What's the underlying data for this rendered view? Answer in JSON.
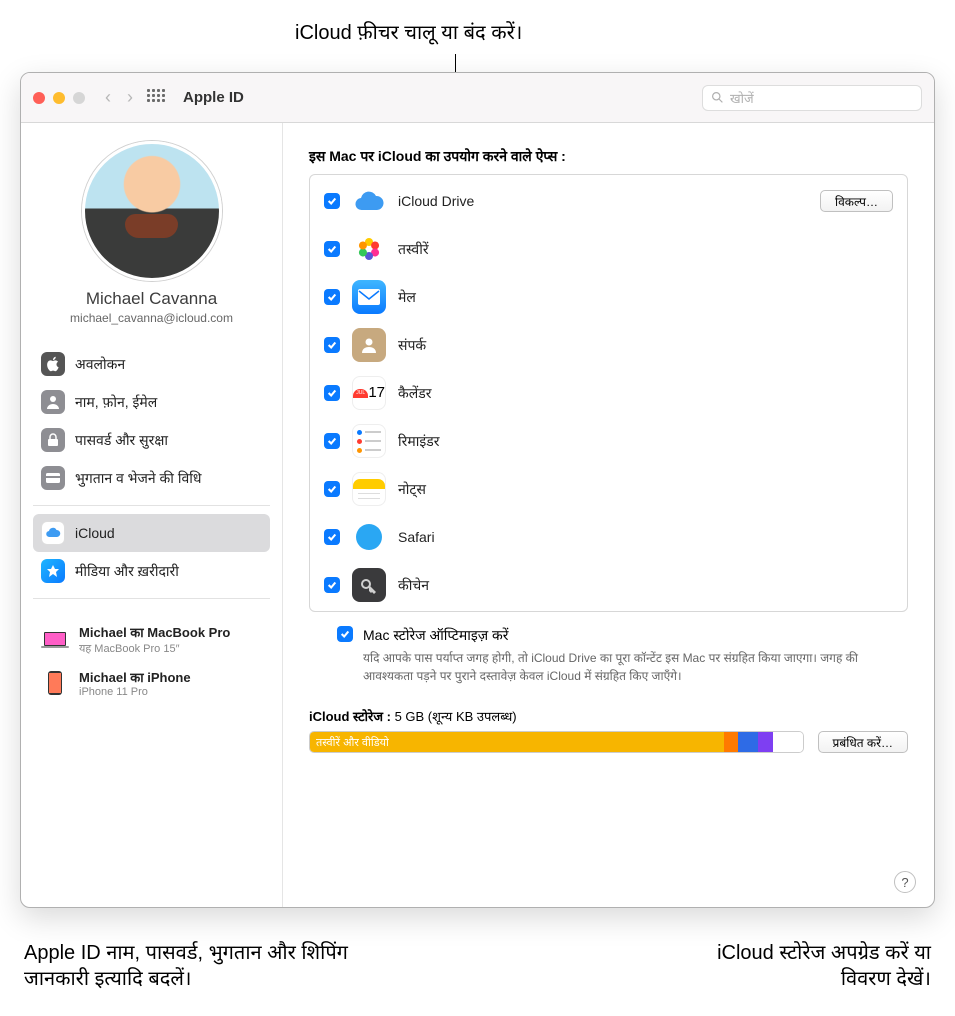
{
  "annotations": {
    "top": "iCloud फ़ीचर चालू या बंद करें।",
    "bottom_left_l1": "Apple ID नाम, पासवर्ड, भुगतान और शिपिंग",
    "bottom_left_l2": "जानकारी इत्यादि बदलें।",
    "bottom_right_l1": "iCloud स्टोरेज अपग्रेड करें या",
    "bottom_right_l2": "विवरण देखें।"
  },
  "window_title": "Apple ID",
  "search_placeholder": "खोजें",
  "user": {
    "name": "Michael Cavanna",
    "email": "michael_cavanna@icloud.com"
  },
  "sidebar": {
    "overview": "अवलोकन",
    "name_phone": "नाम, फ़ोन, ईमेल",
    "password": "पासवर्ड और सुरक्षा",
    "payment": "भुगतान व भेजने की विधि",
    "icloud": "iCloud",
    "media": "मीडिया और ख़रीदारी"
  },
  "devices": {
    "d1": {
      "name": "Michael का MacBook Pro",
      "model": "यह MacBook Pro 15″"
    },
    "d2": {
      "name": "Michael का iPhone",
      "model": "iPhone 11 Pro"
    }
  },
  "main": {
    "apps_heading": "इस Mac पर iCloud का उपयोग करने वाले ऐप्स :",
    "options_btn": "विकल्प…",
    "apps": {
      "drive": "iCloud Drive",
      "photos": "तस्वीरें",
      "mail": "मेल",
      "contacts": "संपर्क",
      "calendar": "कैलेंडर",
      "reminders": "रिमाइंडर",
      "notes": "नोट्स",
      "safari": "Safari",
      "keychain": "कीचेन"
    },
    "optimize_title": "Mac स्टोरेज ऑप्टिमाइज़ करें",
    "optimize_desc": "यदि आपके पास पर्याप्त जगह होगी, तो iCloud Drive का पूरा कॉन्टेंट इस Mac पर संग्रहित किया जाएगा। जगह की आवश्यकता पड़ने पर पुराने दस्तावेज़ केवल iCloud में संग्रहित किए जाएँगे।",
    "storage_label": "iCloud स्टोरेज :",
    "storage_size": "5 GB (शून्य KB उपलब्ध)",
    "bar_photo_label": "तस्वीरें और वीडियो",
    "manage_btn": "प्रबंधित करें…"
  }
}
